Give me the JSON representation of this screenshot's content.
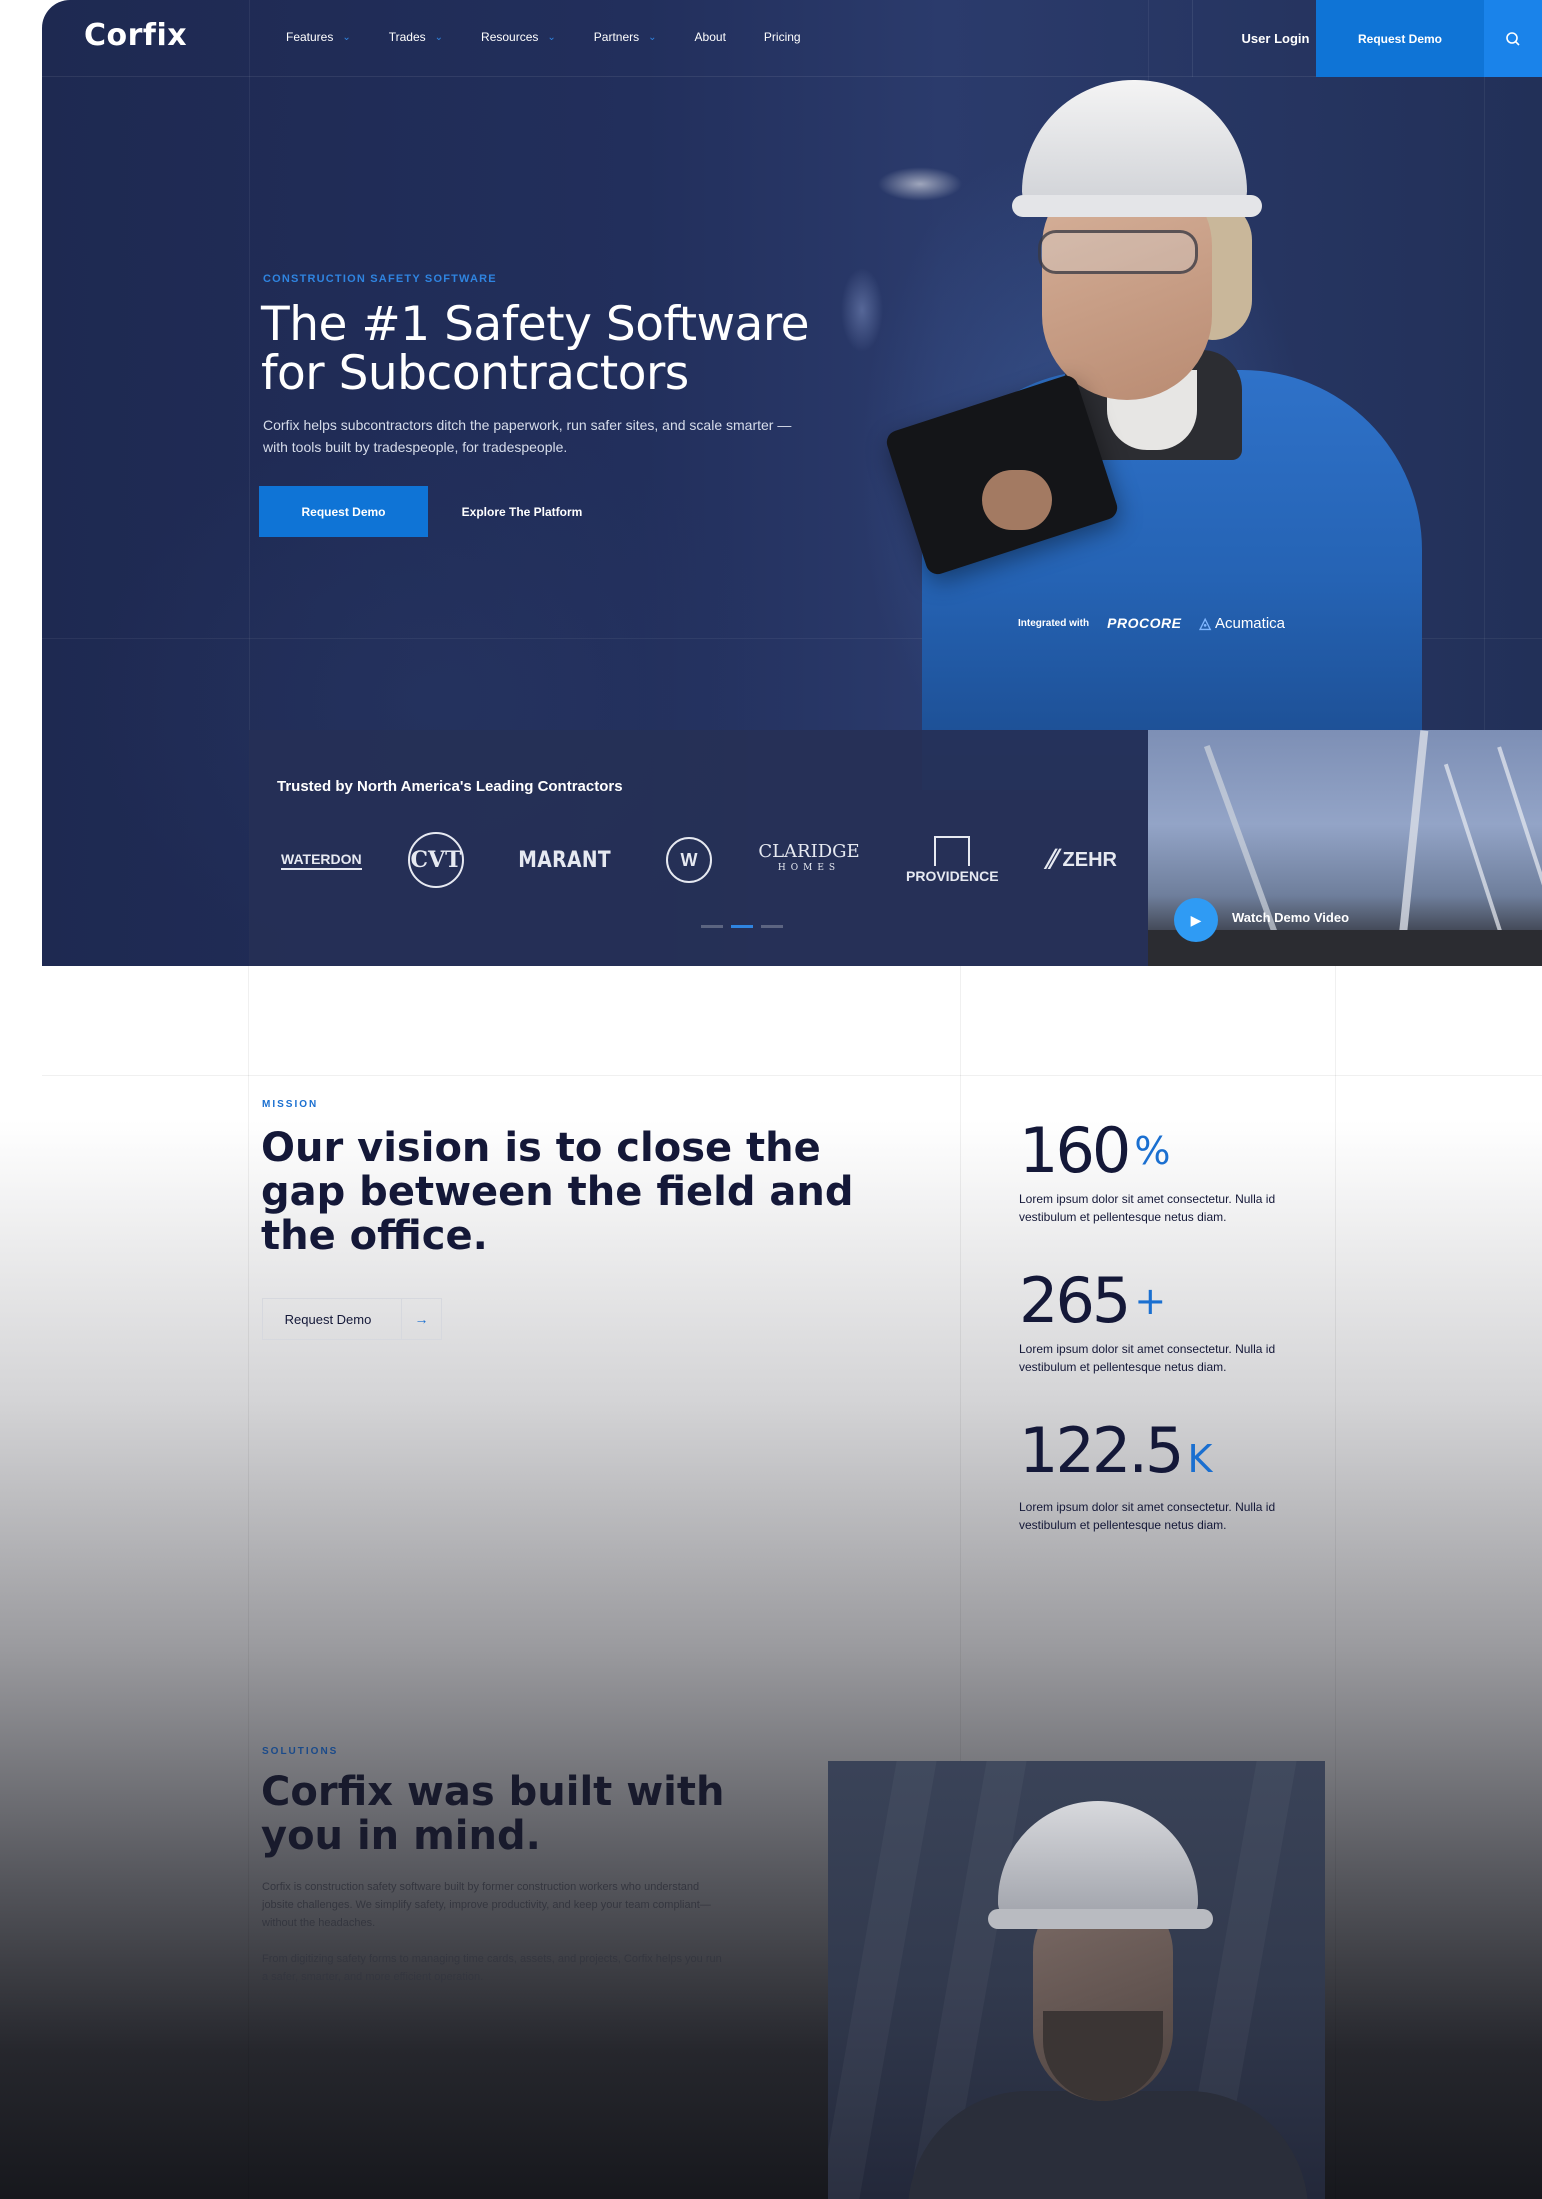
{
  "nav": {
    "logo": "Corfix",
    "items": [
      {
        "label": "Features",
        "dropdown": true
      },
      {
        "label": "Trades",
        "dropdown": true
      },
      {
        "label": "Resources",
        "dropdown": true
      },
      {
        "label": "Partners",
        "dropdown": true
      },
      {
        "label": "About",
        "dropdown": false
      },
      {
        "label": "Pricing",
        "dropdown": false
      }
    ],
    "user_login": "User Login",
    "request_demo": "Request Demo",
    "search_icon": "search-icon"
  },
  "hero": {
    "eyebrow": "CONSTRUCTION SAFETY SOFTWARE",
    "title_line1": "The #1 Safety Software",
    "title_line2": "for Subcontractors",
    "subtitle": "Corfix helps subcontractors ditch the paperwork, run safer sites, and scale smarter — with tools built by tradespeople, for tradespeople.",
    "primary_button": "Request Demo",
    "secondary_button": "Explore The Platform",
    "integrated_label": "Integrated with",
    "integrations": [
      "PROCORE",
      "Acumatica"
    ]
  },
  "trusted": {
    "title": "Trusted by North America's Leading Contractors",
    "logos": {
      "waterdon": "WATERDON",
      "cvt": "CVT",
      "marant": "MARANT",
      "w": "W",
      "claridge": "CLARIDGE",
      "claridge_sub": "HOMES",
      "providence": "PROVIDENCE",
      "zehr": "ZEHR"
    },
    "carousel_active_index": 1,
    "carousel_count": 3
  },
  "video": {
    "label": "Watch Demo Video",
    "play_icon": "play-icon"
  },
  "mission": {
    "eyebrow": "MISSION",
    "title": "Our vision is to close the gap between the field and the office.",
    "button": "Request Demo",
    "arrow_icon": "arrow-right-icon"
  },
  "stats": [
    {
      "value": "160",
      "suffix": "%",
      "desc": "Lorem ipsum dolor sit amet consectetur. Nulla id vestibulum et pellentesque netus diam."
    },
    {
      "value": "265",
      "suffix": "+",
      "desc": "Lorem ipsum dolor sit amet consectetur. Nulla id vestibulum et pellentesque netus diam."
    },
    {
      "value": "122.5",
      "suffix": "K",
      "desc": "Lorem ipsum dolor sit amet consectetur. Nulla id vestibulum et pellentesque netus diam."
    }
  ],
  "solutions": {
    "eyebrow": "SOLUTIONS",
    "title": "Corfix was built with you in mind.",
    "paragraph1": "Corfix is construction safety software built by former construction workers who understand jobsite challenges. We simplify safety, improve productivity, and keep your team compliant—without the headaches.",
    "paragraph2": "From digitizing safety forms to managing time cards, assets, and projects, Corfix helps you run a safer, smarter, and more efficient operation."
  },
  "colors": {
    "brand_blue": "#0f74d6",
    "hero_navy": "#1e2951",
    "heading_dark": "#141838"
  }
}
